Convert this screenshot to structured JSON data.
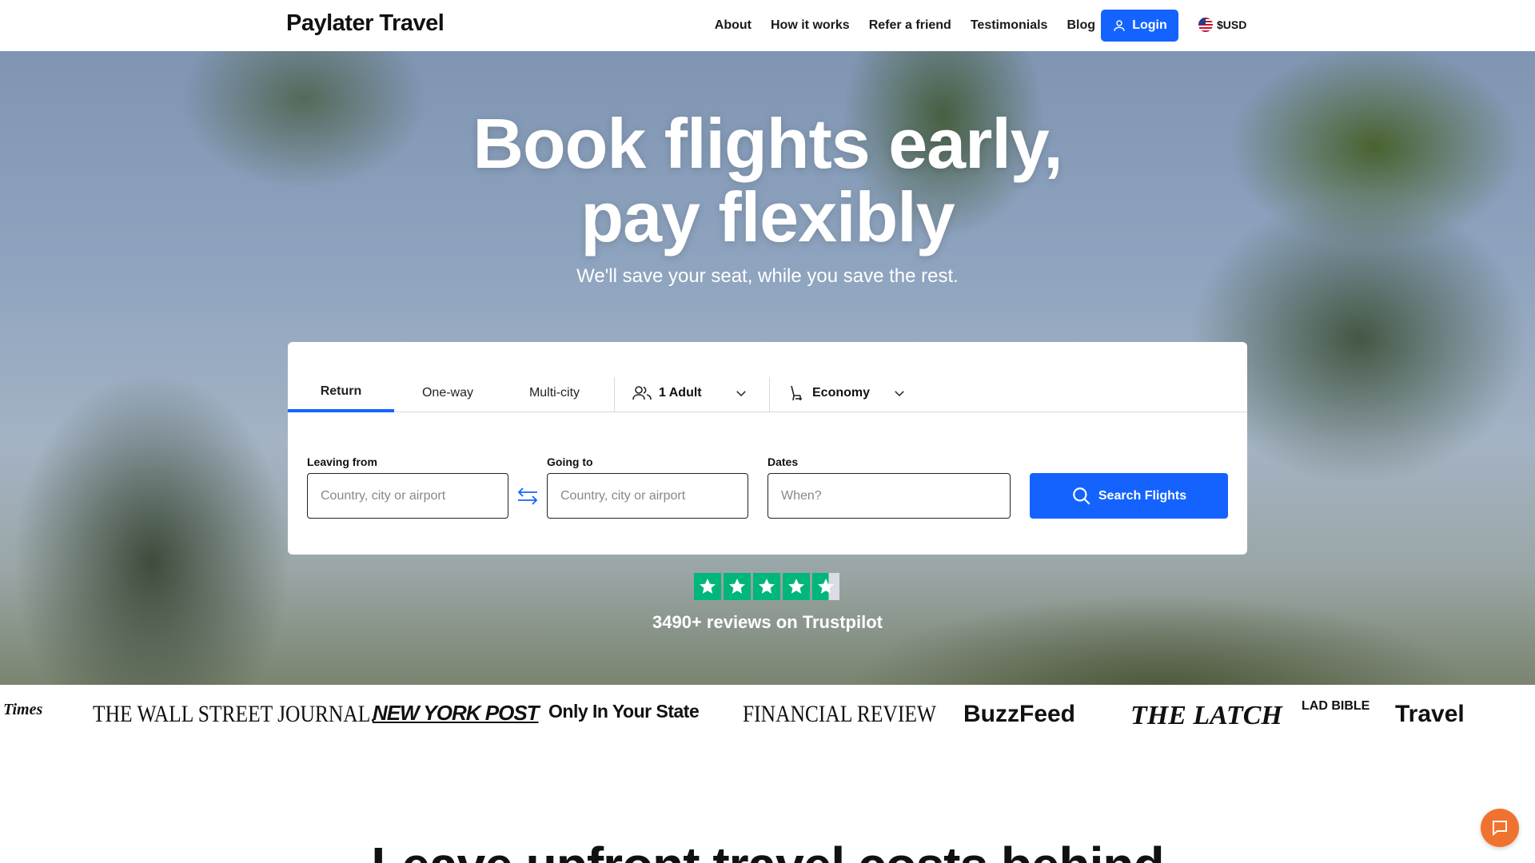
{
  "header": {
    "logo": "Paylater Travel",
    "nav": [
      "About",
      "How it works",
      "Refer a friend",
      "Testimonials",
      "Blog"
    ],
    "login_label": "Login",
    "currency": "$USD"
  },
  "hero": {
    "title_line1": "Book flights early,",
    "title_line2": "pay flexibly",
    "subtitle": "We'll save your seat, while you save the rest."
  },
  "search": {
    "trip_tabs": [
      "Return",
      "One-way",
      "Multi-city"
    ],
    "active_tab": "Return",
    "passengers": "1 Adult",
    "cabin_class": "Economy",
    "leaving_from_label": "Leaving from",
    "leaving_from_placeholder": "Country, city or airport",
    "going_to_label": "Going to",
    "going_to_placeholder": "Country, city or airport",
    "dates_label": "Dates",
    "dates_placeholder": "When?",
    "search_button": "Search Flights",
    "accent_color": "#1463ff"
  },
  "trustpilot": {
    "rating_stars": 4.5,
    "reviews_text": "3490+ reviews on Trustpilot",
    "star_color": "#00b67a"
  },
  "press_logos": [
    "Times",
    "THE WALL STREET JOURNAL.",
    "NEW YORK POST",
    "Only In Your State",
    "FINANCIAL REVIEW",
    "BuzzFeed",
    "THE LATCH",
    "LAD BIBLE",
    "Travel"
  ],
  "next_section": {
    "title": "Leave upfront travel costs behind"
  }
}
